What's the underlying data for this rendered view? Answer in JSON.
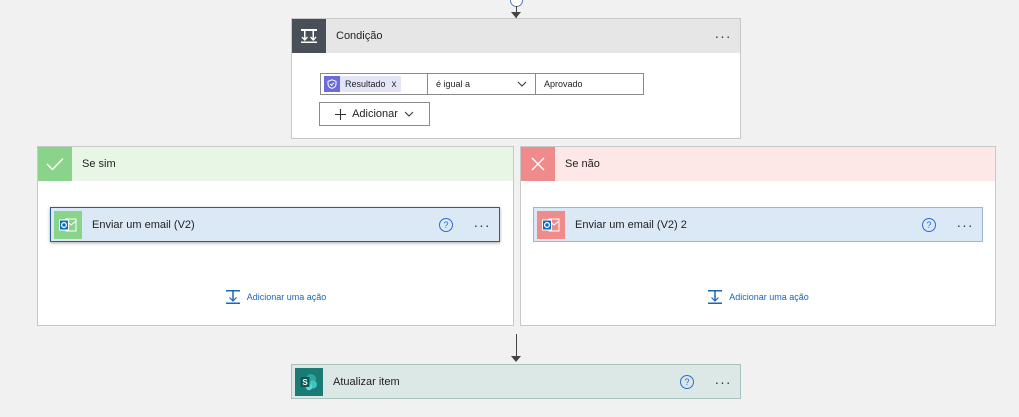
{
  "condition": {
    "title": "Condição",
    "more": "···",
    "token_label": "Resultado",
    "token_remove": "x",
    "operator": "é igual a",
    "value": "Aprovado",
    "add_label": "Adicionar"
  },
  "branch_yes": {
    "title": "Se sim",
    "action_title": "Enviar um email (V2)",
    "help": "?",
    "more": "···",
    "add_action": "Adicionar uma ação"
  },
  "branch_no": {
    "title": "Se não",
    "action_title": "Enviar um email (V2) 2",
    "help": "?",
    "more": "···",
    "add_action": "Adicionar uma ação"
  },
  "update_item": {
    "title": "Atualizar item",
    "help": "?",
    "more": "···"
  },
  "colors": {
    "yes_accent": "#8ad38a",
    "no_accent": "#f08b8b",
    "outlook_blue": "#0f6cbd",
    "sharepoint_teal": "#1c7a74",
    "link_blue": "#1a66b8"
  }
}
